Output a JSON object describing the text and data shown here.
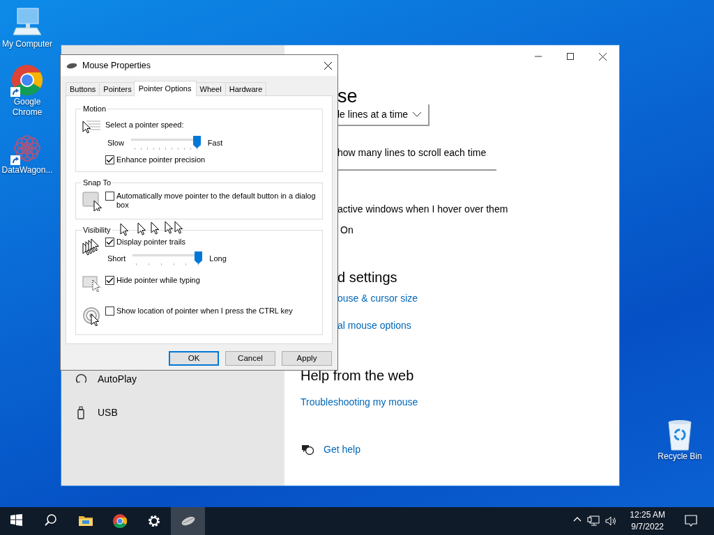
{
  "desktop_icons_left": [
    {
      "label": "My Computer",
      "kind": "computer",
      "shortcut": false
    },
    {
      "label": "Google Chrome",
      "kind": "chrome",
      "shortcut": true
    },
    {
      "label": "DataWagon...",
      "kind": "datawagon",
      "shortcut": true
    }
  ],
  "desktop_icons_right": [
    {
      "label": "Recycle Bin",
      "kind": "recycle",
      "shortcut": false
    }
  ],
  "settings_window": {
    "sidebar_items": [
      {
        "label": "AutoPlay",
        "kind": "autoplay"
      },
      {
        "label": "USB",
        "kind": "usb"
      }
    ],
    "heading": "se",
    "scroll_dropdown": "le lines at a time",
    "scroll_lines_label": "how many lines to scroll each time",
    "inactive_scroll_label": "active windows when I hover over them",
    "toggle_label": "On",
    "related_heading": "d settings",
    "related_links": [
      "ouse & cursor size",
      "al mouse options"
    ],
    "help_heading": "Help from the web",
    "help_links": [
      "Troubleshooting my mouse"
    ],
    "get_help": "Get help"
  },
  "dialog": {
    "title": "Mouse Properties",
    "tabs": [
      {
        "label": "Buttons",
        "selected": false
      },
      {
        "label": "Pointers",
        "selected": false
      },
      {
        "label": "Pointer Options",
        "selected": true
      },
      {
        "label": "Wheel",
        "selected": false
      },
      {
        "label": "Hardware",
        "selected": false
      }
    ],
    "groups": [
      {
        "legend": "Motion",
        "sections": [
          {
            "kind": "speed",
            "controls": [
              {
                "kind": "label",
                "text": "Select a pointer speed:"
              },
              {
                "kind": "slider",
                "min_label": "Slow",
                "max_label": "Fast",
                "level": 1
              },
              {
                "kind": "checkbox",
                "label": "Enhance pointer precision",
                "checked": true
              }
            ]
          }
        ]
      },
      {
        "legend": "Snap To",
        "sections": [
          {
            "kind": "snap",
            "controls": [
              {
                "kind": "checkbox",
                "label": "Automatically move pointer to the default button in a dialog box",
                "checked": false
              }
            ]
          }
        ]
      },
      {
        "legend": "Visibility",
        "sections": [
          {
            "kind": "trails",
            "controls": [
              {
                "kind": "checkbox",
                "label": "Display pointer trails",
                "checked": true
              },
              {
                "kind": "slider",
                "min_label": "Short",
                "max_label": "Long",
                "level": 1
              }
            ]
          },
          {
            "kind": "hide",
            "controls": [
              {
                "kind": "checkbox",
                "label": "Hide pointer while typing",
                "checked": true
              }
            ]
          },
          {
            "kind": "locate",
            "controls": [
              {
                "kind": "checkbox",
                "label": "Show location of pointer when I press the CTRL key",
                "checked": false
              }
            ]
          }
        ]
      }
    ],
    "buttons": [
      {
        "label": "OK",
        "default": true
      },
      {
        "label": "Cancel",
        "default": false
      },
      {
        "label": "Apply",
        "default": false
      }
    ]
  },
  "taskbar": {
    "apps": [
      {
        "kind": "start",
        "active": false
      },
      {
        "kind": "search",
        "active": false
      },
      {
        "kind": "explorer",
        "active": false
      },
      {
        "kind": "chrome",
        "active": false
      },
      {
        "kind": "settings",
        "active": false
      },
      {
        "kind": "mouse",
        "active": true
      }
    ],
    "tray": [
      {
        "kind": "chevron"
      },
      {
        "kind": "network"
      },
      {
        "kind": "volume"
      }
    ],
    "clock_time": "12:25 AM",
    "clock_date": "9/7/2022"
  }
}
